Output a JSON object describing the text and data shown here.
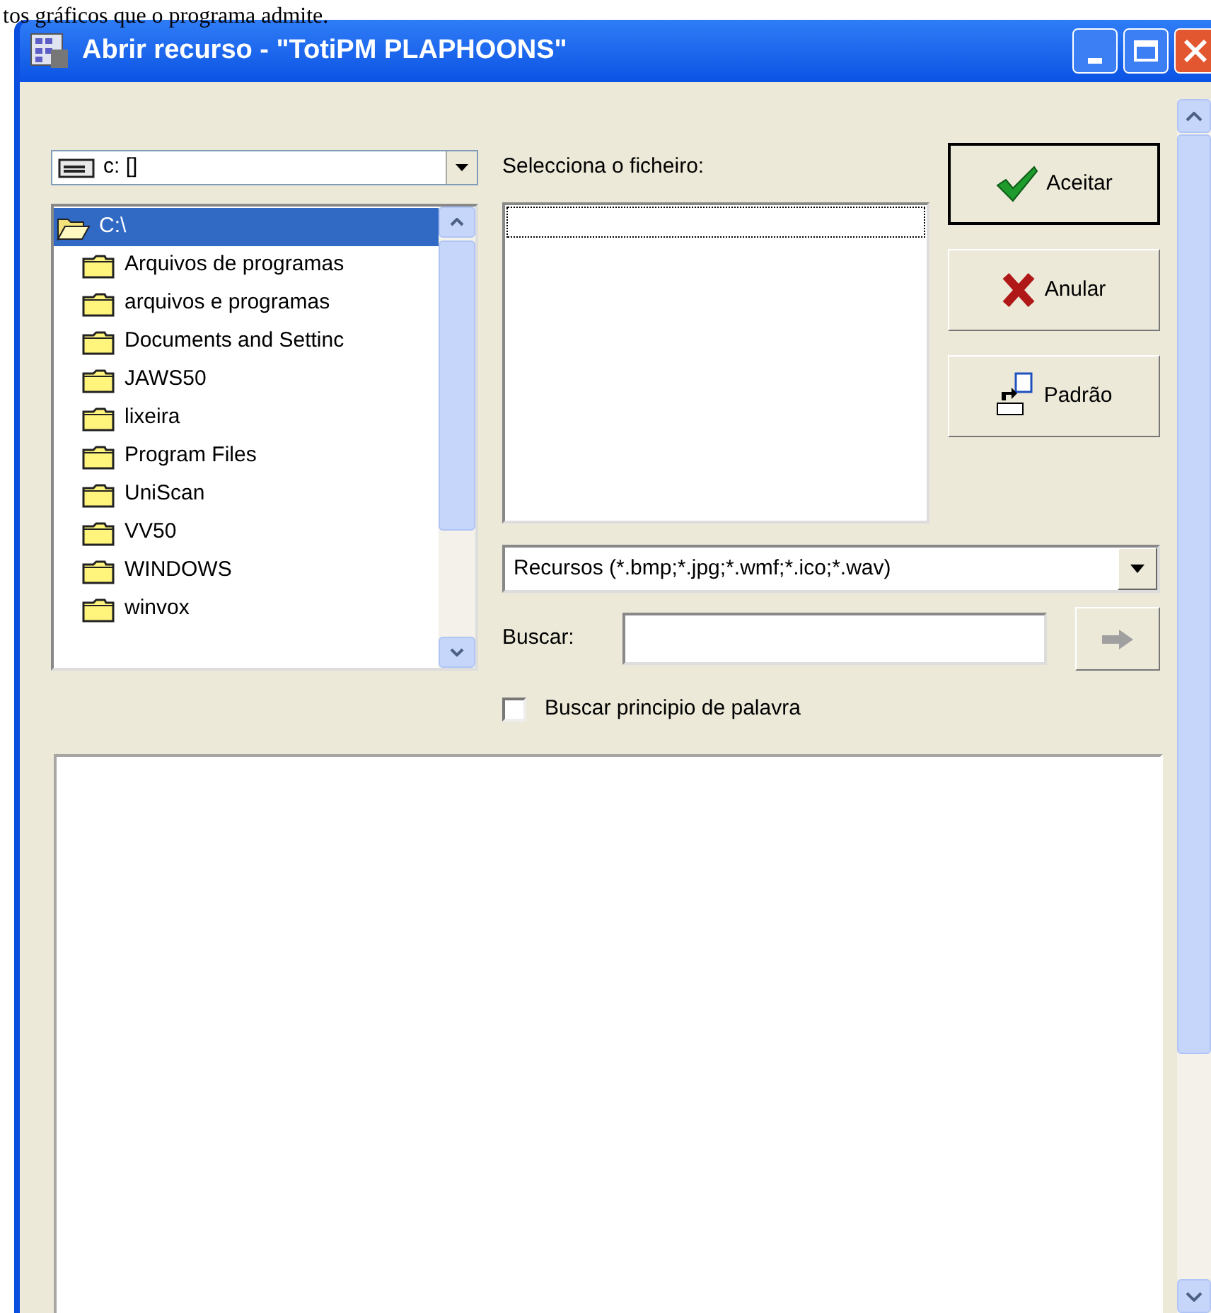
{
  "caption": "tos gráficos que o programa admite.",
  "window": {
    "title": "Abrir recurso - \"TotiPM PLAPHOONS\""
  },
  "drive_combo": {
    "value": "c: []"
  },
  "folder_tree": {
    "items": [
      {
        "label": "C:\\",
        "selected": true,
        "expanded": true
      },
      {
        "label": "Arquivos de programas",
        "selected": false,
        "expanded": false
      },
      {
        "label": "arquivos e programas",
        "selected": false,
        "expanded": false
      },
      {
        "label": "Documents and Settinc",
        "selected": false,
        "expanded": false
      },
      {
        "label": "JAWS50",
        "selected": false,
        "expanded": false
      },
      {
        "label": "lixeira",
        "selected": false,
        "expanded": false
      },
      {
        "label": "Program Files",
        "selected": false,
        "expanded": false
      },
      {
        "label": "UniScan",
        "selected": false,
        "expanded": false
      },
      {
        "label": "VV50",
        "selected": false,
        "expanded": false
      },
      {
        "label": "WINDOWS",
        "selected": false,
        "expanded": false
      },
      {
        "label": "winvox",
        "selected": false,
        "expanded": false
      }
    ]
  },
  "file_list": {
    "label": "Selecciona o ficheiro:"
  },
  "buttons": [
    {
      "label": "Aceitar",
      "kind": "accept",
      "default": true
    },
    {
      "label": "Anular",
      "kind": "cancel",
      "default": false
    },
    {
      "label": "Padrão",
      "kind": "reset",
      "default": false
    }
  ],
  "filter_combo": {
    "value": "Recursos (*.bmp;*.jpg;*.wmf;*.ico;*.wav)"
  },
  "search": {
    "label": "Buscar:",
    "go_disabled": true
  },
  "word_start_checkbox": {
    "label": "Buscar principio de palavra",
    "checked": false
  }
}
